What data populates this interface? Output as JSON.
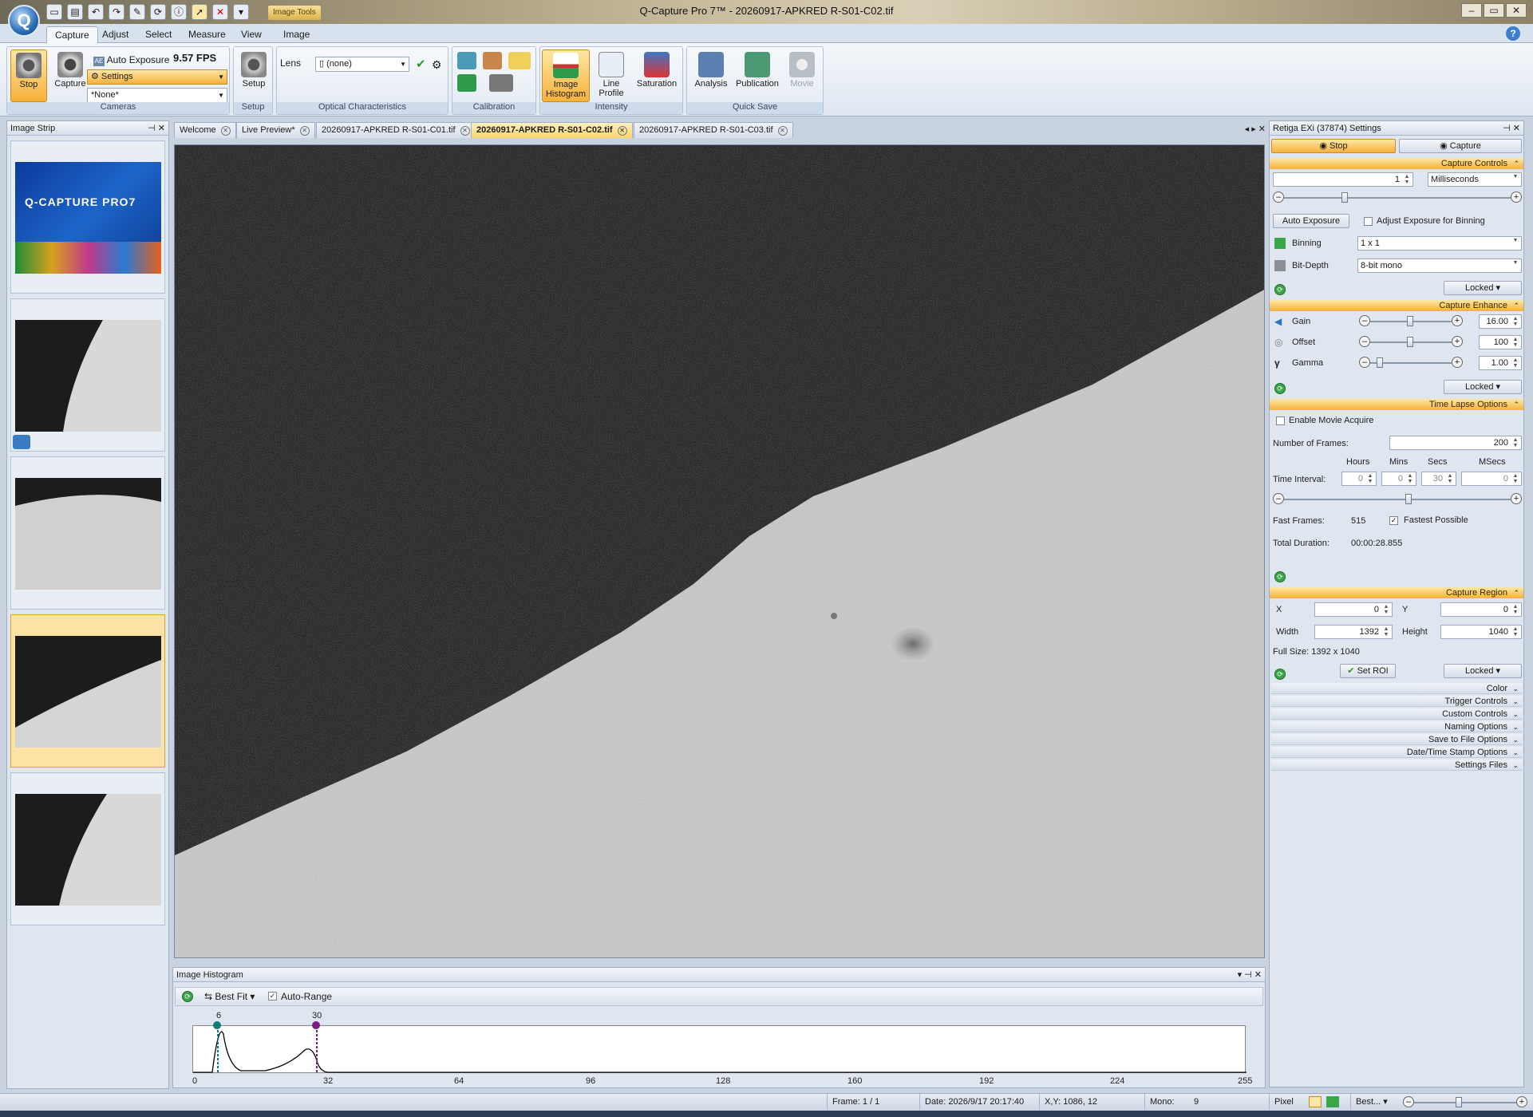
{
  "window": {
    "title": "Q-Capture Pro 7™ - 20260917-APKRED R-S01-C02.tif",
    "context_tab": "Image Tools",
    "app_logo": "Q"
  },
  "ribbon_tabs": [
    "Capture",
    "Adjust",
    "Select",
    "Measure",
    "View",
    "Image"
  ],
  "ribbon": {
    "cameras": {
      "stop_label": "Stop",
      "capture_label": "Capture",
      "auto_exposure": "Auto Exposure",
      "fps": "9.57 FPS",
      "settings": "Settings",
      "preset": "*None*",
      "title": "Cameras"
    },
    "setup": {
      "label": "Setup",
      "title": "Setup"
    },
    "optical": {
      "lens_label": "Lens",
      "lens_value": "(none)",
      "title": "Optical Characteristics"
    },
    "calibration": {
      "title": "Calibration"
    },
    "intensity": {
      "histogram": "Image Histogram",
      "line_profile": "Line Profile",
      "saturation": "Saturation",
      "title": "Intensity"
    },
    "quicksave": {
      "analysis": "Analysis",
      "publication": "Publication",
      "movie": "Movie",
      "title": "Quick Save"
    }
  },
  "image_strip": {
    "title": "Image Strip",
    "splash_text": "Q-CAPTURE PRO7"
  },
  "doc_tabs": [
    "Welcome",
    "Live Preview*",
    "20260917-APKRED R-S01-C01.tif",
    "20260917-APKRED R-S01-C02.tif",
    "20260917-APKRED R-S01-C03.tif"
  ],
  "histogram": {
    "title": "Image Histogram",
    "fit": "Best Fit",
    "auto_range": "Auto-Range",
    "marker_low": "6",
    "marker_high": "30",
    "ticks": [
      "0",
      "32",
      "64",
      "96",
      "128",
      "160",
      "192",
      "224",
      "255"
    ]
  },
  "settings": {
    "title": "Retiga EXi (37874) Settings",
    "stop": "Stop",
    "capture": "Capture",
    "capture_controls": {
      "title": "Capture Controls",
      "exposure": "1",
      "exposure_unit": "Milliseconds",
      "auto_exposure": "Auto Exposure",
      "adjust_binning": "Adjust Exposure for Binning",
      "binning_label": "Binning",
      "binning_value": "1 x 1",
      "bitdepth_label": "Bit-Depth",
      "bitdepth_value": "8-bit mono",
      "locked": "Locked"
    },
    "capture_enhance": {
      "title": "Capture Enhance",
      "gain_label": "Gain",
      "gain_value": "16.00",
      "offset_label": "Offset",
      "offset_value": "100",
      "gamma_label": "Gamma",
      "gamma_value": "1.00",
      "locked": "Locked"
    },
    "time_lapse": {
      "title": "Time Lapse Options",
      "enable_movie": "Enable Movie Acquire",
      "frames_label": "Number of Frames:",
      "frames_value": "200",
      "hours": "Hours",
      "mins": "Mins",
      "secs": "Secs",
      "msecs": "MSecs",
      "interval_label": "Time Interval:",
      "h_val": "0",
      "m_val": "0",
      "s_val": "30",
      "ms_val": "0",
      "fast_frames_label": "Fast Frames:",
      "fast_frames_value": "515",
      "fastest": "Fastest Possible",
      "duration_label": "Total Duration:",
      "duration_value": "00:00:28.855"
    },
    "capture_region": {
      "title": "Capture Region",
      "x_label": "X",
      "x_value": "0",
      "y_label": "Y",
      "y_value": "0",
      "width_label": "Width",
      "width_value": "1392",
      "height_label": "Height",
      "height_value": "1040",
      "full_size": "Full Size: 1392 x 1040",
      "set_roi": "Set ROI",
      "locked": "Locked"
    },
    "collapsed": [
      "Color",
      "Trigger Controls",
      "Custom Controls",
      "Naming Options",
      "Save to File Options",
      "Date/Time Stamp Options",
      "Settings Files"
    ]
  },
  "status": {
    "frame": "Frame: 1 / 1",
    "date": "Date: 2026/9/17 20:17:40",
    "xy": "X,Y: 1086,   12",
    "mono_label": "Mono:",
    "mono_value": "9",
    "pixel": "Pixel",
    "zoom": "Best..."
  }
}
